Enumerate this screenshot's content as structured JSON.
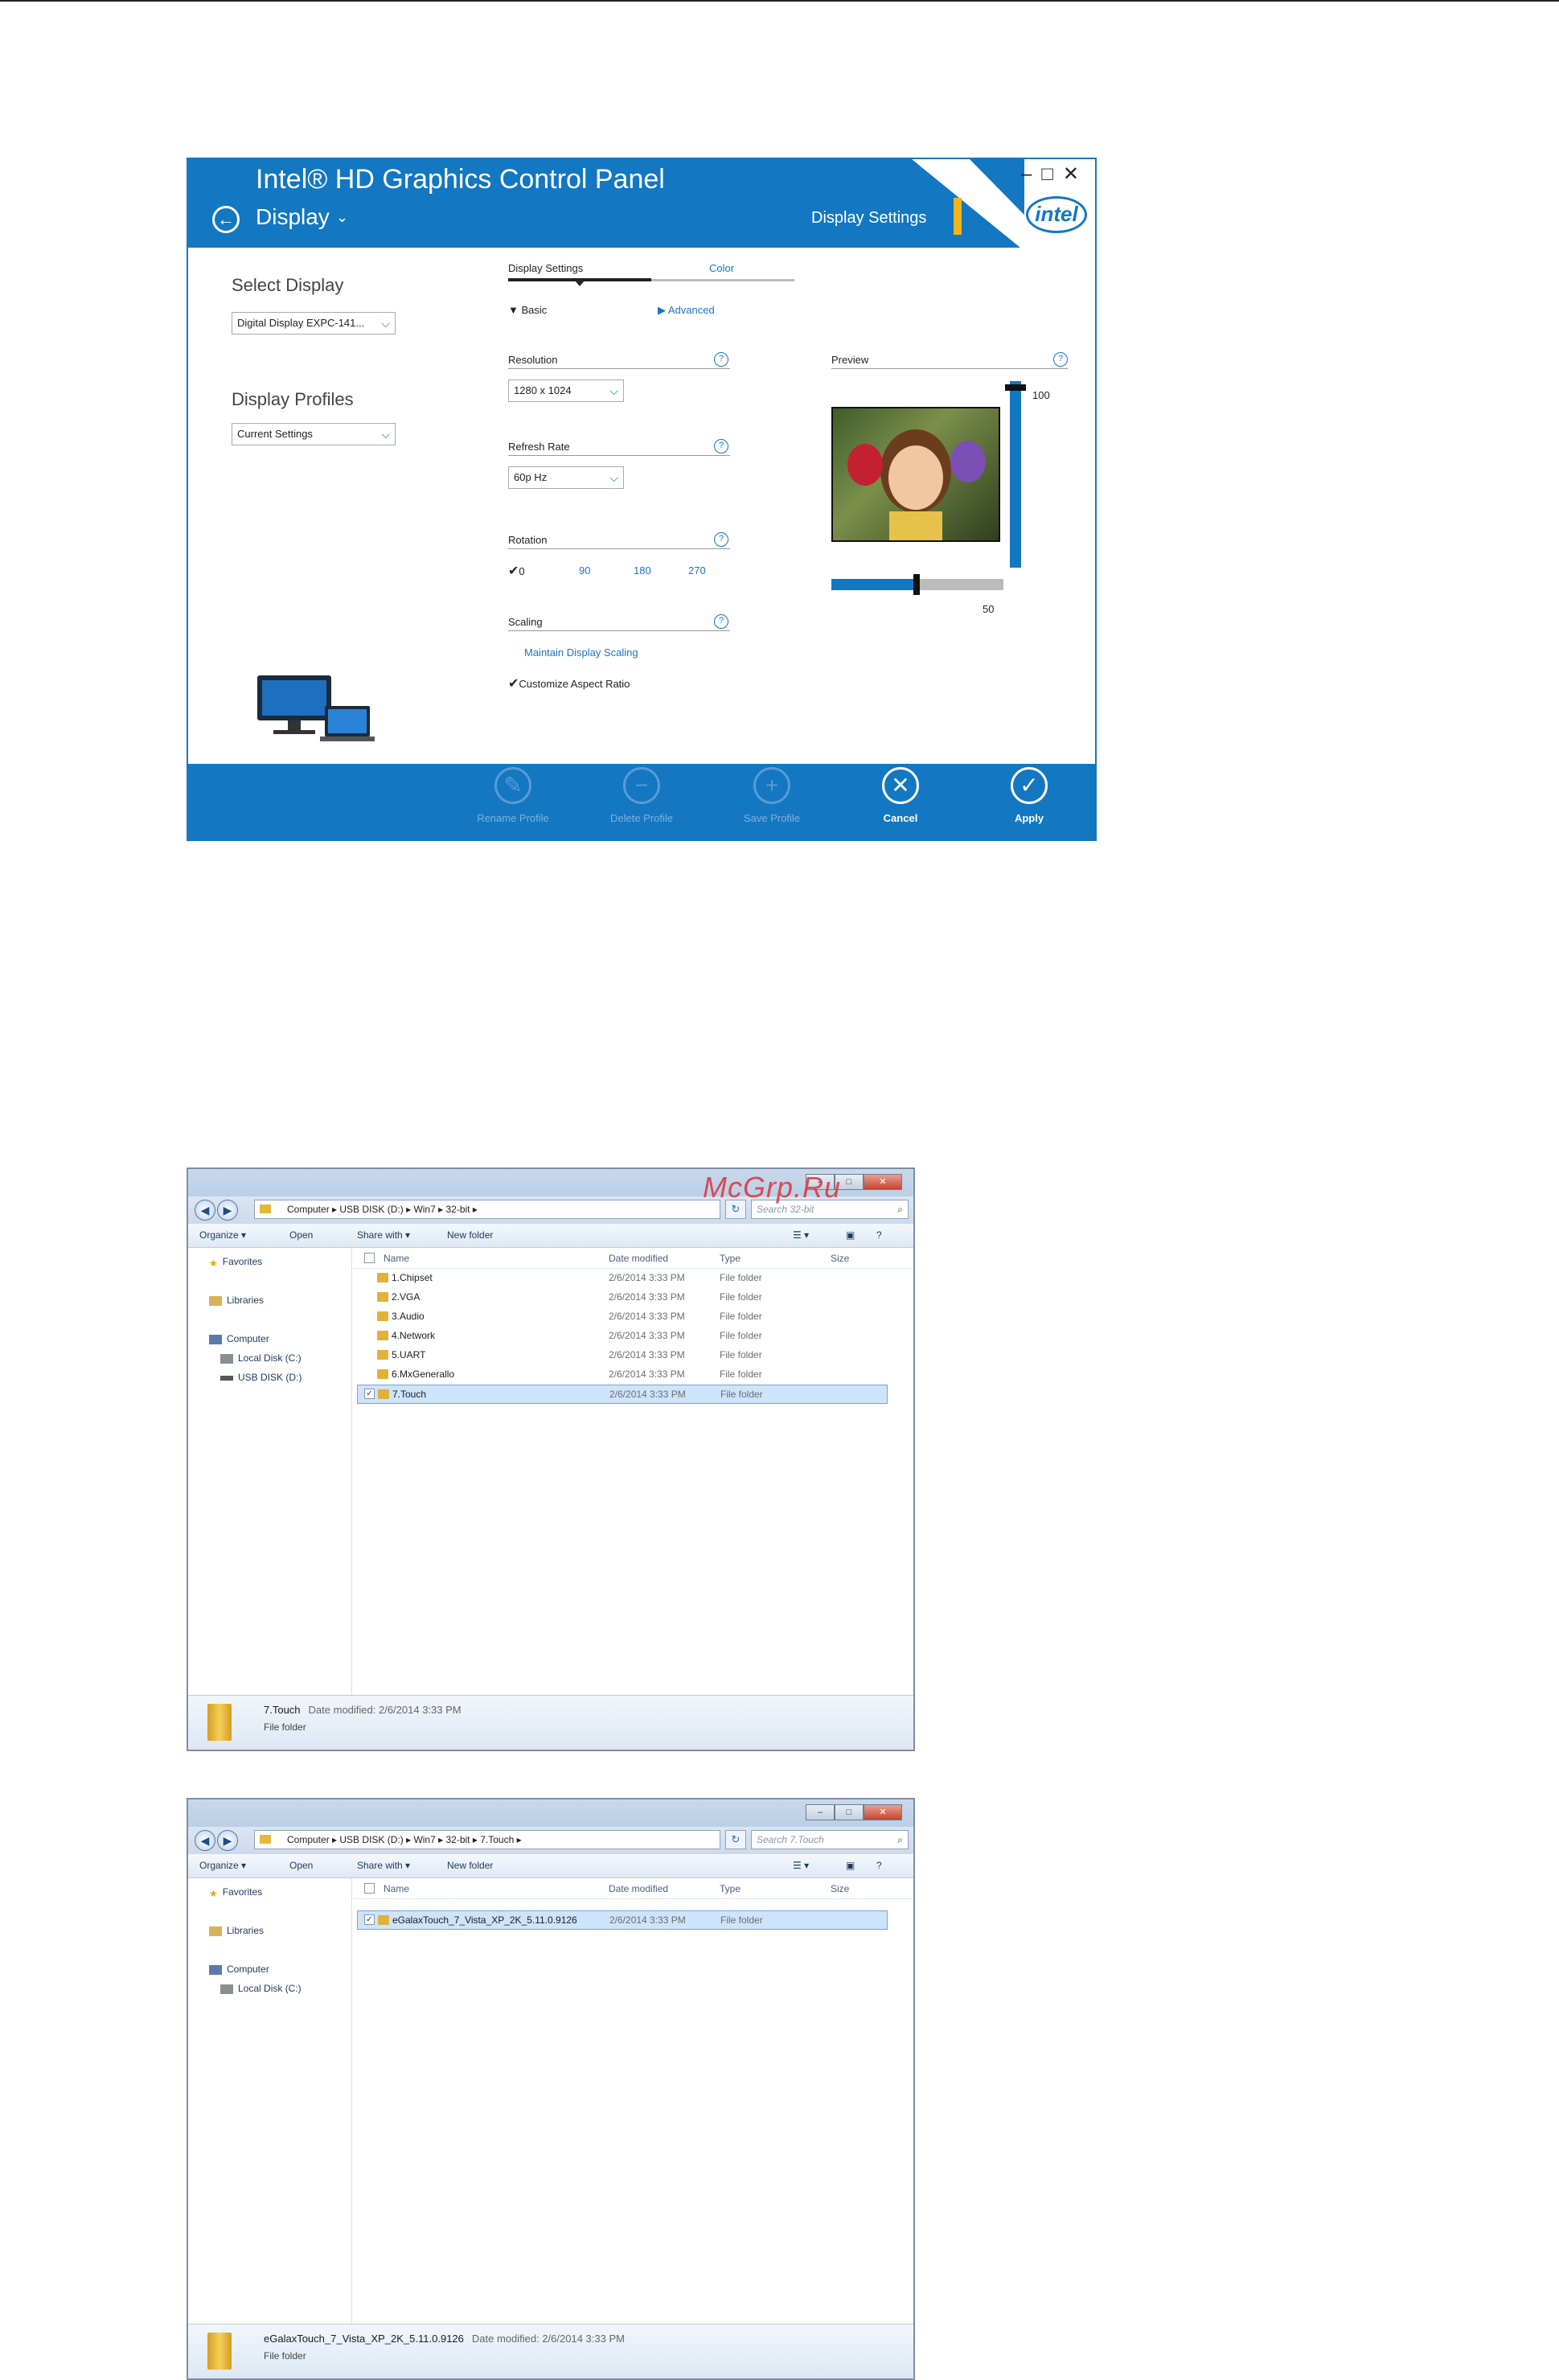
{
  "intel_panel": {
    "title": "Intel® HD Graphics Control Panel",
    "section": "Display",
    "section_right": "Display Settings",
    "logo_text": "intel",
    "window_controls": [
      "–",
      "□",
      "✕"
    ],
    "left": {
      "select_display_label": "Select Display",
      "select_display_value": "Digital Display EXPC-141...",
      "profiles_label": "Display Profiles",
      "profiles_value": "Current Settings"
    },
    "tabs": [
      "Display Settings",
      "Color"
    ],
    "modes": {
      "basic": "Basic",
      "advanced": "Advanced"
    },
    "resolution": {
      "label": "Resolution",
      "value": "1280 x 1024"
    },
    "refresh": {
      "label": "Refresh Rate",
      "value": "60p Hz"
    },
    "rotation": {
      "label": "Rotation",
      "options": [
        "0",
        "90",
        "180",
        "270"
      ],
      "selected": "0"
    },
    "scaling": {
      "label": "Scaling",
      "option1": "Maintain Display Scaling",
      "option2": "Customize Aspect Ratio"
    },
    "preview": {
      "label": "Preview",
      "vertical_value": "100",
      "horizontal_value": "50"
    },
    "footer": [
      "Rename Profile",
      "Delete Profile",
      "Save Profile",
      "Cancel",
      "Apply"
    ],
    "colors": {
      "header": "#1377c2",
      "accent": "#f3b41a"
    }
  },
  "explorer1": {
    "breadcrumb": [
      "Computer",
      "USB DISK (D:)",
      "Win7",
      "32-bit"
    ],
    "search_placeholder": "Search 32-bit",
    "toolbar": [
      "Organize ▾",
      "Open",
      "Share with ▾",
      "New folder"
    ],
    "nav": [
      "Favorites",
      "Libraries",
      "Computer",
      "Local Disk (C:)",
      "USB DISK (D:)"
    ],
    "columns": [
      "Name",
      "Date modified",
      "Type",
      "Size"
    ],
    "rows": [
      {
        "name": "1.Chipset",
        "date": "2/6/2014 3:33 PM",
        "type": "File folder"
      },
      {
        "name": "2.VGA",
        "date": "2/6/2014 3:33 PM",
        "type": "File folder"
      },
      {
        "name": "3.Audio",
        "date": "2/6/2014 3:33 PM",
        "type": "File folder"
      },
      {
        "name": "4.Network",
        "date": "2/6/2014 3:33 PM",
        "type": "File folder"
      },
      {
        "name": "5.UART",
        "date": "2/6/2014 3:33 PM",
        "type": "File folder"
      },
      {
        "name": "6.MxGenerallo",
        "date": "2/6/2014 3:33 PM",
        "type": "File folder"
      },
      {
        "name": "7.Touch",
        "date": "2/6/2014 3:33 PM",
        "type": "File folder"
      }
    ],
    "details": {
      "name": "7.Touch",
      "date_label": "Date modified: 2/6/2014 3:33 PM",
      "type": "File folder"
    }
  },
  "explorer2": {
    "breadcrumb": [
      "Computer",
      "USB DISK (D:)",
      "Win7",
      "32-bit",
      "7.Touch"
    ],
    "search_placeholder": "Search 7.Touch",
    "toolbar": [
      "Organize ▾",
      "Open",
      "Share with ▾",
      "New folder"
    ],
    "nav": [
      "Favorites",
      "Libraries",
      "Computer",
      "Local Disk (C:)"
    ],
    "columns": [
      "Name",
      "Date modified",
      "Type",
      "Size"
    ],
    "rows": [
      {
        "name": "eGalaxTouch_7_Vista_XP_2K_5.11.0.9126",
        "date": "2/6/2014 3:33 PM",
        "type": "File folder"
      }
    ],
    "details": {
      "name": "eGalaxTouch_7_Vista_XP_2K_5.11.0.9126",
      "date_label": "Date modified: 2/6/2014 3:33 PM",
      "type": "File folder"
    }
  },
  "watermark": "McGrp.Ru"
}
